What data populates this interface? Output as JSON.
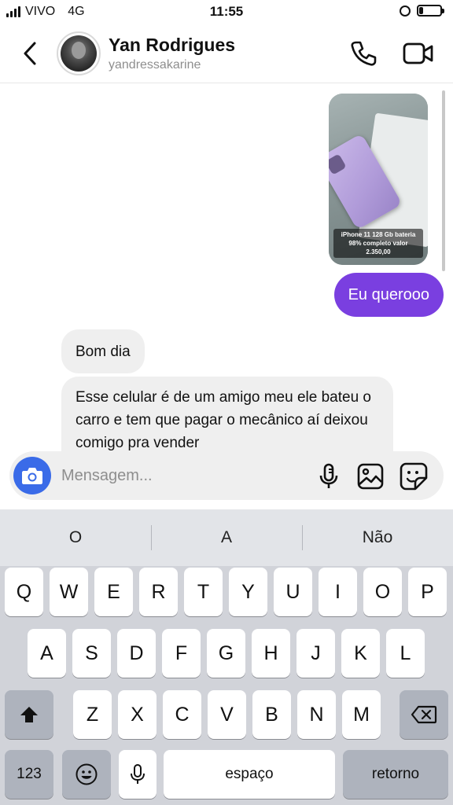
{
  "status_bar": {
    "carrier": "VIVO",
    "network": "4G",
    "time": "11:55",
    "battery_level": 0.2
  },
  "header": {
    "name": "Yan Rodrigues",
    "username": "yandressakarine",
    "icons": {
      "back": "chevron-left-icon",
      "call": "phone-icon",
      "video": "video-camera-icon"
    }
  },
  "messages": [
    {
      "from": "me",
      "type": "image",
      "caption": "iPhone 11 128 Gb bateria 98% completo valor 2.350,00"
    },
    {
      "from": "me",
      "type": "text",
      "text": "Eu querooo"
    },
    {
      "from": "them",
      "type": "text",
      "text": "Bom dia"
    },
    {
      "from": "them",
      "type": "text",
      "text": "Esse celular é de um amigo meu ele bateu o carro e tem que pagar o mecânico aí deixou comigo pra vender"
    }
  ],
  "composer": {
    "placeholder": "Mensagem...",
    "icons": {
      "camera": "camera-icon",
      "mic": "microphone-icon",
      "gallery": "image-icon",
      "sticker": "sticker-icon"
    }
  },
  "colors": {
    "sent_bubble": "#7a3fe0",
    "received_bubble": "#efefef",
    "camera_button": "#3a6be8",
    "keyboard_bg": "#d1d3d9"
  },
  "keyboard": {
    "suggestions": [
      "O",
      "A",
      "Não"
    ],
    "row1": [
      "Q",
      "W",
      "E",
      "R",
      "T",
      "Y",
      "U",
      "I",
      "O",
      "P"
    ],
    "row2": [
      "A",
      "S",
      "D",
      "F",
      "G",
      "H",
      "J",
      "K",
      "L"
    ],
    "row3": [
      "Z",
      "X",
      "C",
      "V",
      "B",
      "N",
      "M"
    ],
    "numbers_label": "123",
    "space_label": "espaço",
    "return_label": "retorno"
  }
}
